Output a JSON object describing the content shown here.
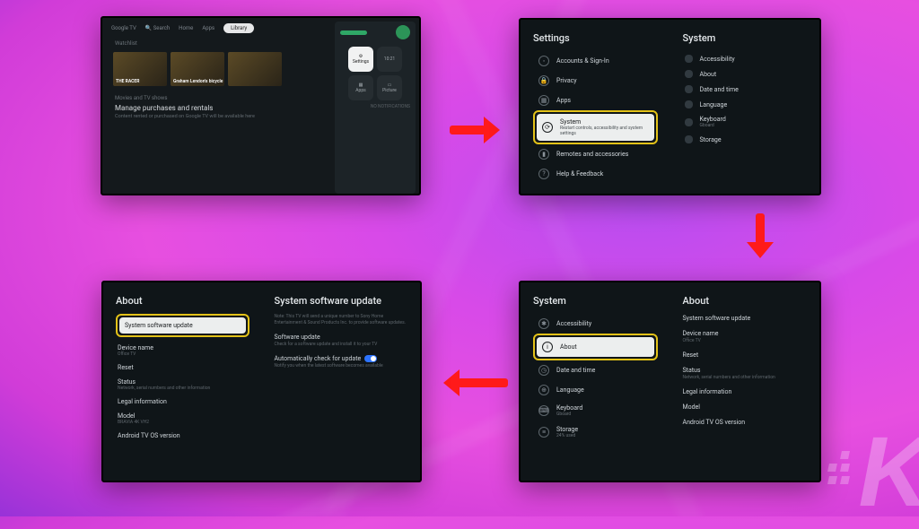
{
  "tv1": {
    "brand": "Google TV",
    "nav": {
      "search": "Search",
      "home": "Home",
      "apps": "Apps",
      "library": "Library"
    },
    "watchlist_label": "Watchlist",
    "tiles": {
      "t1": "THE\nRACER",
      "t2": "Graham Lendon's bicycle",
      "t3": ""
    },
    "shows_label": "Movies and TV shows",
    "manage_title": "Manage purchases and rentals",
    "manage_sub": "Content rented or purchased on Google TV will be available here",
    "quick": {
      "settings": "Settings",
      "apps": "Apps",
      "picture": "Picture",
      "no_notif": "NO NOTIFICATIONS",
      "time": "10:21"
    }
  },
  "tv2": {
    "left_title": "Settings",
    "right_title": "System",
    "left": [
      {
        "label": "Accounts & Sign-In"
      },
      {
        "label": "Privacy"
      },
      {
        "label": "Apps"
      },
      {
        "label": "System",
        "sub": "Restart controls, accessibility and system settings"
      },
      {
        "label": "Remotes and accessories"
      },
      {
        "label": "Help & Feedback"
      }
    ],
    "right": [
      {
        "label": "Accessibility"
      },
      {
        "label": "About"
      },
      {
        "label": "Date and time"
      },
      {
        "label": "Language"
      },
      {
        "label": "Keyboard",
        "sub": "Gboard"
      },
      {
        "label": "Storage"
      }
    ]
  },
  "tv3": {
    "left_title": "System",
    "right_title": "About",
    "left": [
      {
        "label": "Accessibility"
      },
      {
        "label": "About"
      },
      {
        "label": "Date and time"
      },
      {
        "label": "Language"
      },
      {
        "label": "Keyboard",
        "sub": "Gboard"
      },
      {
        "label": "Storage",
        "sub": "24% used"
      }
    ],
    "right": [
      {
        "label": "System software update"
      },
      {
        "label": "Device name",
        "sub": "Office TV"
      },
      {
        "label": "Reset"
      },
      {
        "label": "Status",
        "sub": "Network, serial numbers and other information"
      },
      {
        "label": "Legal information"
      },
      {
        "label": "Model",
        "sub": ""
      },
      {
        "label": "Android TV OS version"
      }
    ]
  },
  "tv4": {
    "left_title": "About",
    "right_title": "System software update",
    "right_sub": "Note: This TV will send a unique number to Sony Home Entertainment & Sound Products Inc. to provide software updates.",
    "left": [
      {
        "label": "System software update"
      },
      {
        "label": "Device name",
        "sub": "Office TV"
      },
      {
        "label": "Reset"
      },
      {
        "label": "Status",
        "sub": "Network, serial numbers and other information"
      },
      {
        "label": "Legal information"
      },
      {
        "label": "Model",
        "sub": "BRAVIA 4K VH2"
      },
      {
        "label": "Android TV OS version"
      }
    ],
    "right": [
      {
        "label": "Software update",
        "sub": "Check for a software update and install it to your TV"
      },
      {
        "label": "Automatically check for update",
        "sub": "Notify you when the latest software becomes available"
      }
    ]
  }
}
